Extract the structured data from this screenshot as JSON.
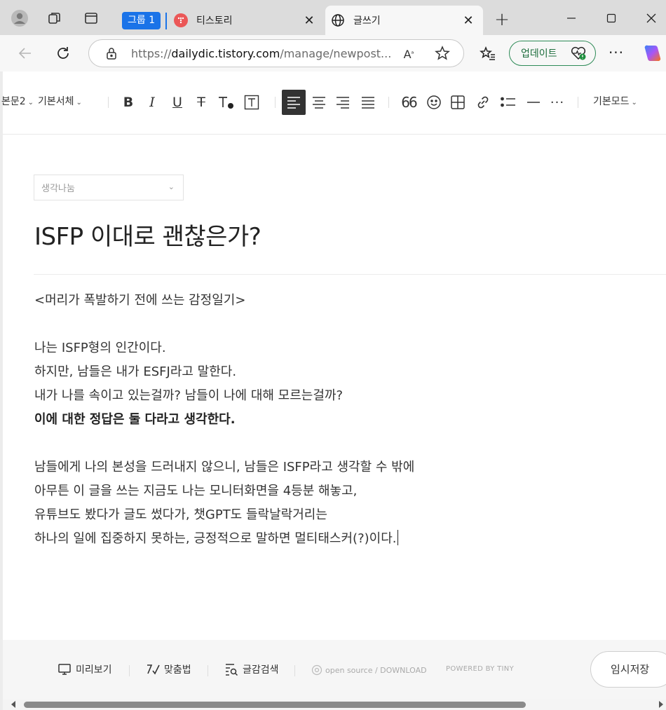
{
  "browser": {
    "tab_group_label": "그룹 1",
    "tabs": [
      {
        "title": "티스토리",
        "active": false
      },
      {
        "title": "글쓰기",
        "active": true
      }
    ],
    "url_prefix": "https://",
    "url_host": "dailydic.tistory.com",
    "url_rest": "/manage/newpost...",
    "update_label": "업데이트",
    "colors": {
      "group": "#1a73e8",
      "update_border": "#2e8b57",
      "tistory": "#eb5757"
    }
  },
  "toolbar": {
    "heading_select": "본문2",
    "font_select": "기본서체",
    "mode_select": "기본모드"
  },
  "editor": {
    "category_placeholder": "생각나눔",
    "title": "ISFP 이대로 괜찮은가?",
    "lines": [
      {
        "text": "<머리가 폭발하기 전에 쓰는 감정일기>",
        "style": "normal"
      },
      {
        "text": "",
        "style": "blank"
      },
      {
        "text": "나는 ISFP형의 인간이다.",
        "style": "normal"
      },
      {
        "text": "하지만, 남들은 내가 ESFJ라고 말한다.",
        "style": "normal"
      },
      {
        "text": "내가 나를 속이고 있는걸까? 남들이 나에 대해 모르는걸까?",
        "style": "normal"
      },
      {
        "text": "이에 대한 정답은 둘 다라고 생각한다.",
        "style": "bold"
      },
      {
        "text": "",
        "style": "blank"
      },
      {
        "text": "남들에게 나의 본성을 드러내지 않으니, 남들은 ISFP라고 생각할 수 밖에",
        "style": "normal"
      },
      {
        "text": "아무튼 이 글을 쓰는 지금도 나는 모니터화면을 4등분 해놓고,",
        "style": "normal"
      },
      {
        "text": "유튜브도 봤다가 글도 썼다가, 챗GPT도 들락날락거리는",
        "style": "normal"
      },
      {
        "text": "하나의 일에 집중하지 못하는, 긍정적으로 말하면 멀티태스커(?)이다.",
        "style": "normal"
      }
    ]
  },
  "footer": {
    "preview_label": "미리보기",
    "spellcheck_label": "맞춤법",
    "search_label": "글감검색",
    "open_source": "open source / DOWNLOAD",
    "powered_by": "POWERED BY TINY",
    "save_label": "임시저장"
  }
}
